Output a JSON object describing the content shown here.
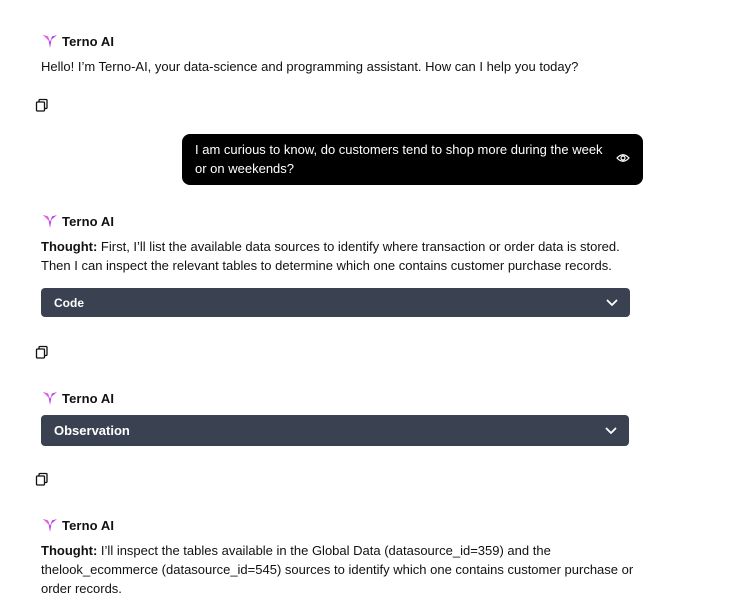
{
  "agent_name": "Terno AI",
  "messages": {
    "greeting": "Hello! I’m Terno-AI, your data-science and programming assistant. How can I help you today?",
    "user_question": "I am curious to know, do customers tend to shop more during the week or on weekends?",
    "thought1_label": "Thought:",
    "thought1_text": " First, I’ll list the available data sources to identify where transaction or order data is stored. Then I can inspect the relevant tables to determine which one contains customer purchase records.",
    "code_label": "Code",
    "observation_label": "Observation",
    "thought2_label": "Thought:",
    "thought2_text": " I’ll inspect the tables available in the Global Data (datasource_id=359) and the thelook_ecommerce (datasource_id=545) sources to identify which one contains customer purchase or order records."
  },
  "colors": {
    "user_bubble": "#000000",
    "collapse_bg": "#3a4252",
    "logo_purple": "#b23bf0",
    "logo_pink": "#e25de0"
  },
  "icons": [
    "terno-logo-icon",
    "copy-icon",
    "eye-icon",
    "chevron-down-icon"
  ]
}
